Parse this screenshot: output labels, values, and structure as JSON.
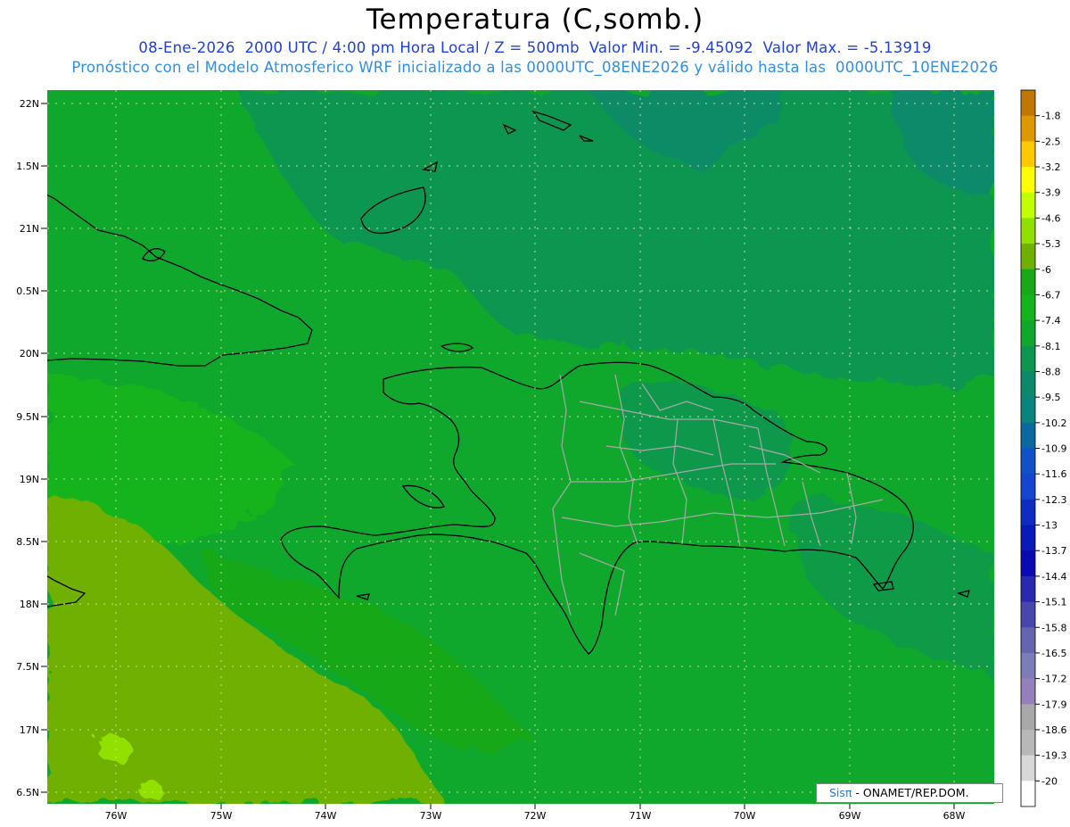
{
  "header": {
    "title": "Temperatura (C,somb.)",
    "line1": "08-Ene-2026  2000 UTC / 4:00 pm Hora Local / Z = 500mb  Valor Min. = -9.45092  Valor Max. = -5.13919",
    "line2": "Pronóstico con el Modelo Atmosferico WRF inicializado a las 0000UTC_08ENE2026 y válido hasta las  0000UTC_10ENE2026"
  },
  "map": {
    "lat_labels": [
      "22N",
      "1.5N",
      "21N",
      "0.5N",
      "20N",
      "9.5N",
      "19N",
      "8.5N",
      "18N",
      "7.5N",
      "17N",
      "6.5N"
    ],
    "lon_labels": [
      "76W",
      "75W",
      "74W",
      "73W",
      "72W",
      "71W",
      "70W",
      "69W",
      "68W"
    ]
  },
  "colorbar": {
    "labels": [
      "-1.8",
      "-2.5",
      "-3.2",
      "-3.9",
      "-4.6",
      "-5.3",
      "-6",
      "-6.7",
      "-7.4",
      "-8.1",
      "-8.8",
      "-9.5",
      "-10.2",
      "-10.9",
      "-11.6",
      "-12.3",
      "-13",
      "-13.7",
      "-14.4",
      "-15.1",
      "-15.8",
      "-16.5",
      "-17.2",
      "-17.9",
      "-18.6",
      "-19.3",
      "-20"
    ],
    "colors": [
      "#c07800",
      "#e09800",
      "#ffc800",
      "#ffff00",
      "#c0ff00",
      "#90e000",
      "#70b000",
      "#18a818",
      "#14b41e",
      "#10a82c",
      "#0c9650",
      "#0a8a6a",
      "#08867e",
      "#0a6aa0",
      "#1050c8",
      "#1444d0",
      "#0e2cc4",
      "#0a1ab8",
      "#0a0ab4",
      "#2828b0",
      "#4848ac",
      "#6464b0",
      "#7c7cb8",
      "#9680bc",
      "#a8a8a8",
      "#b8b8b8",
      "#d8d8d8",
      "#ffffff"
    ]
  },
  "credit": {
    "logo": "Sisπ",
    "text": " - ONAMET/REP.DOM."
  }
}
